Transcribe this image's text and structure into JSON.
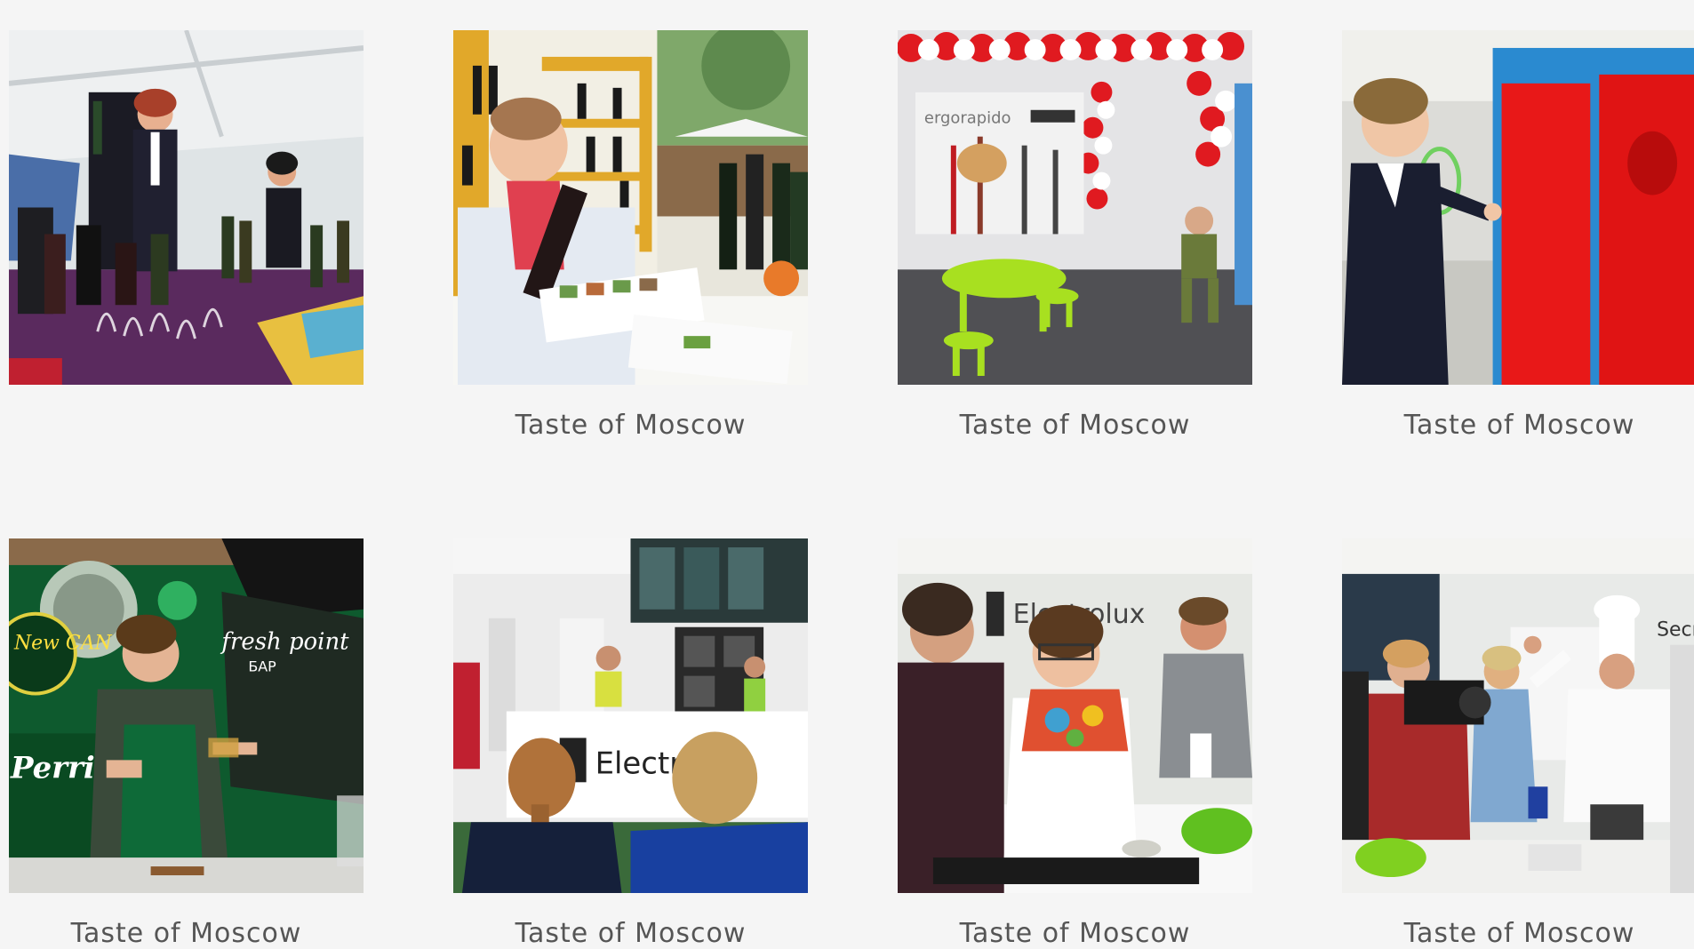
{
  "gallery": {
    "items": [
      {
        "caption": "",
        "photo": "wine-tasting-booth-photo"
      },
      {
        "caption": "Taste of Moscow",
        "photo": "wine-presenter-photo"
      },
      {
        "caption": "Taste of Moscow",
        "photo": "balloon-arch-booth-photo"
      },
      {
        "caption": "Taste of Moscow",
        "photo": "red-wall-visitor-photo"
      },
      {
        "caption": "Taste of Moscow",
        "photo": "perrier-bar-photo"
      },
      {
        "caption": "Taste of Moscow",
        "photo": "electrolux-audience-photo"
      },
      {
        "caption": "Taste of Moscow",
        "photo": "cooking-class-women-photo"
      },
      {
        "caption": "Taste of Moscow",
        "photo": "chef-demo-camera-photo"
      }
    ]
  },
  "photo_texts": {
    "ergorapido": "ergorapido",
    "fresh_point": "fresh point",
    "bar": "БАР",
    "perrier": "Perrier",
    "new_can": "New CAN",
    "electrolux_1": "Electr",
    "electrolux_2": "Electrolux",
    "secret": "Secret"
  }
}
